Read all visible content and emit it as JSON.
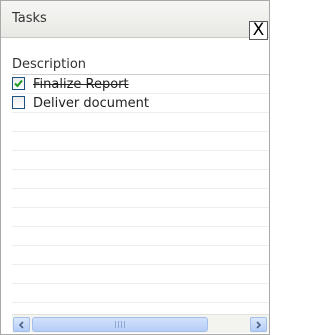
{
  "window": {
    "title": "Tasks",
    "close_glyph": "X"
  },
  "table": {
    "columns": [
      "Description"
    ],
    "rows": [
      {
        "description": "Finalize Report",
        "checked": true
      },
      {
        "description": "Deliver document",
        "checked": false
      }
    ]
  },
  "icons": {
    "close": "close-icon",
    "check": "checkmark-icon",
    "scroll_left": "arrow-left-icon",
    "scroll_right": "arrow-right-icon",
    "thumb_grip": "grip-icon"
  },
  "colors": {
    "checkmark": "#1f9c1f",
    "checkbox_border": "#1c5180",
    "scroll_blue": "#b4cdf7"
  }
}
